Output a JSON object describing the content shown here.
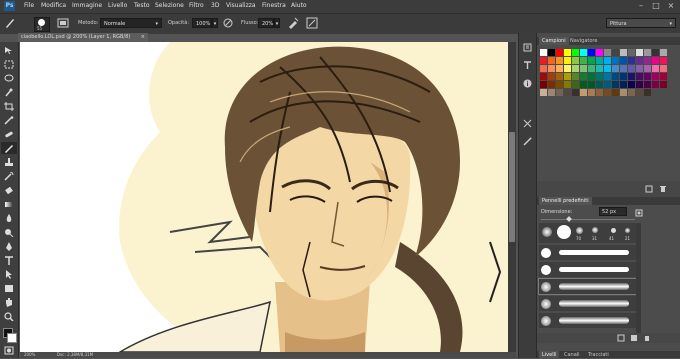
{
  "app": {
    "logo": "Ps",
    "menu": [
      "File",
      "Modifica",
      "Immagine",
      "Livello",
      "Testo",
      "Selezione",
      "Filtro",
      "3D",
      "Visualizza",
      "Finestra",
      "Aiuto"
    ]
  },
  "options": {
    "brush_size": "55",
    "metodo_label": "Metodo:",
    "metodo_value": "Normale",
    "opacita_label": "Opacità:",
    "opacita_value": "100%",
    "flusso_label": "Flusso:",
    "flusso_value": "20%",
    "workspace": "Pittura"
  },
  "document": {
    "tab_title": "ciaobello.LOL.psd @ 200% (Layer 1, RGB/8)",
    "status_zoom": "200%",
    "status_doc": "Doc: 2,38M/8,31M"
  },
  "tools": [
    "move-tool",
    "marquee-tool",
    "lasso-tool",
    "quick-selection-tool",
    "crop-tool",
    "eyedropper-tool",
    "healing-tool",
    "brush-tool",
    "clone-stamp-tool",
    "history-brush-tool",
    "eraser-tool",
    "gradient-tool",
    "blur-tool",
    "dodge-tool",
    "pen-tool",
    "type-tool",
    "path-selection-tool",
    "shape-tool",
    "hand-tool",
    "zoom-tool"
  ],
  "colors": {
    "foreground": "#111111",
    "background": "#ffffff",
    "accent": "#3a3a3a"
  },
  "panels": {
    "swatches_tab": "Campioni",
    "navigator_tab": "Navigatore",
    "brush_presets_tab": "Pennelli predefiniti",
    "dimensione_label": "Dimensione:",
    "dimensione_value": "52 px",
    "brush_numbers": [
      "70",
      "31",
      "41",
      "21"
    ],
    "bottom_tabs": [
      "Livelli",
      "Canali",
      "Tracciati"
    ]
  }
}
